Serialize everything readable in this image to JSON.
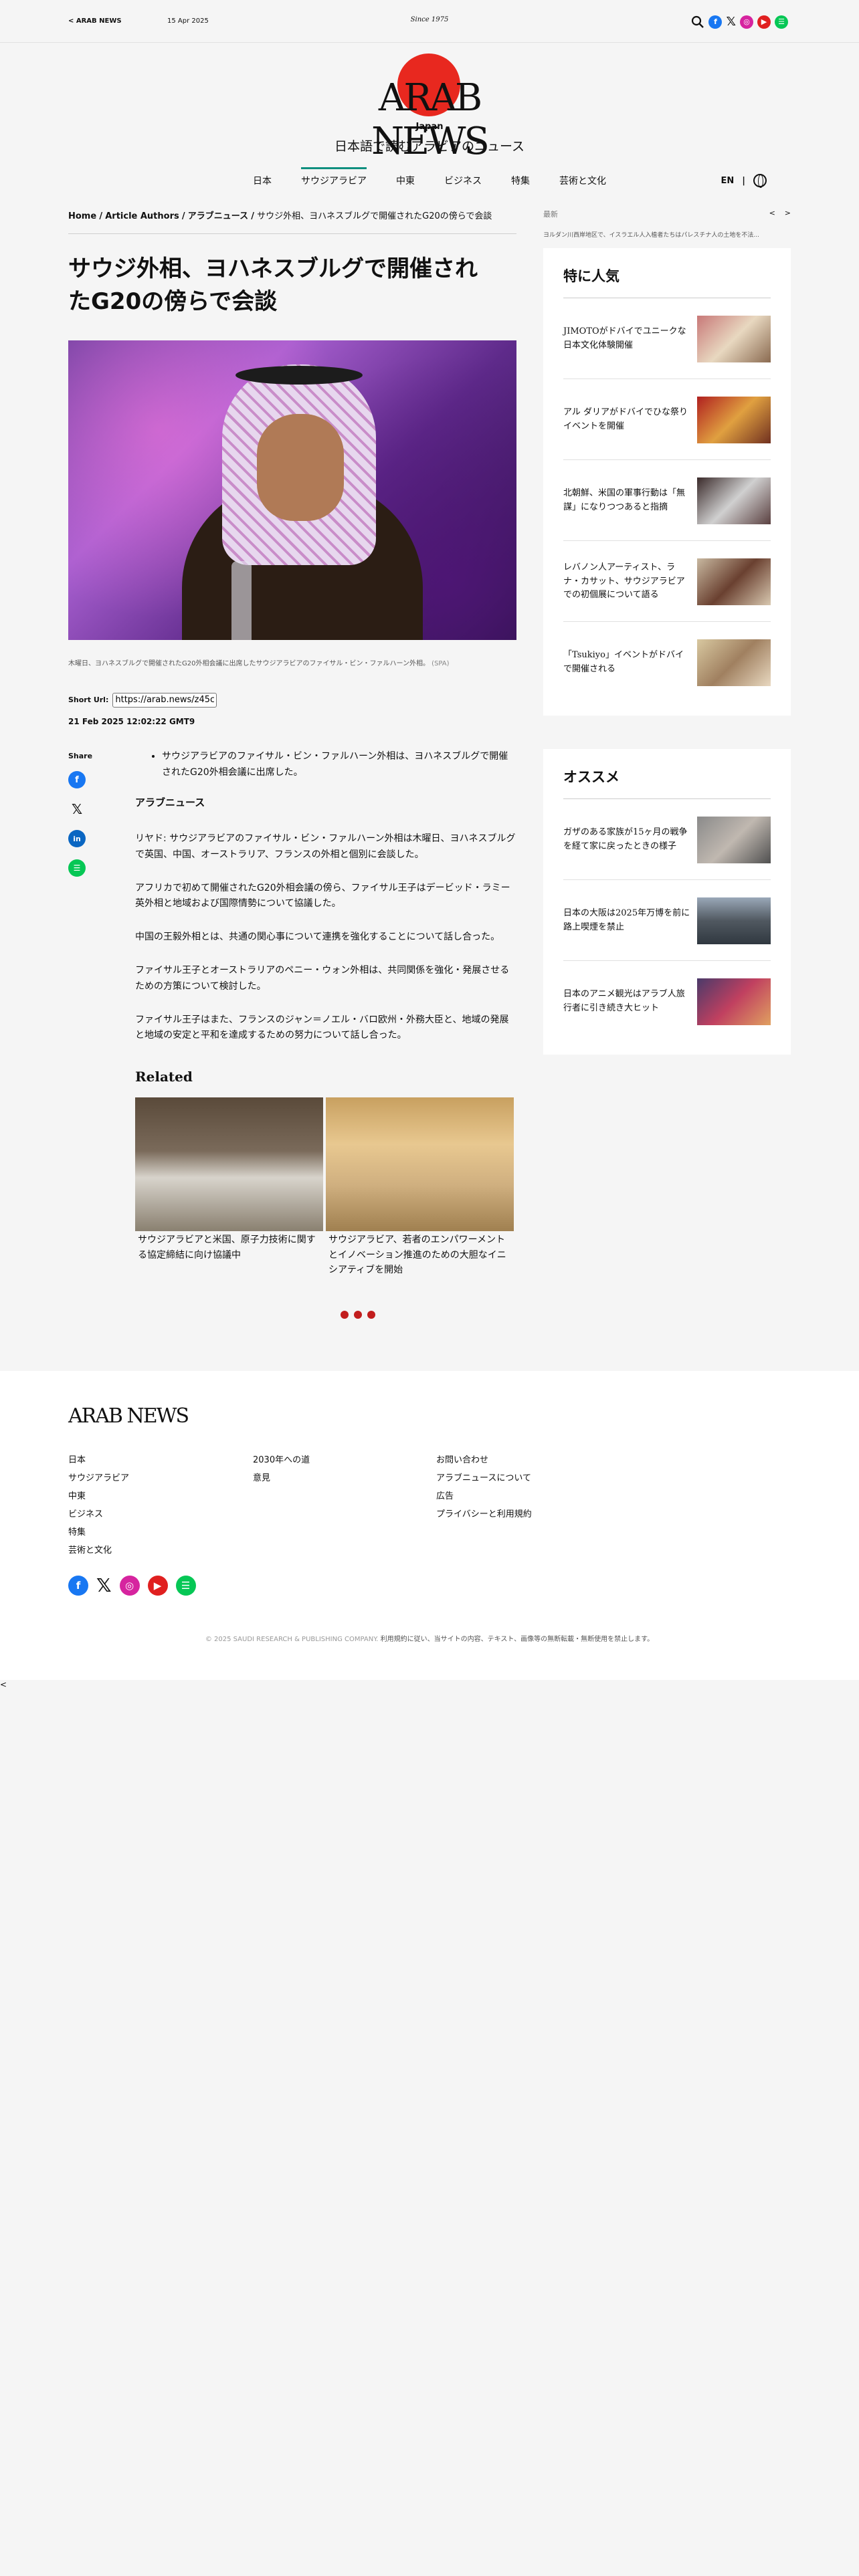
{
  "topbar": {
    "back_label": "< ARAB NEWS",
    "date": "15 Apr 2025",
    "since": "Since 1975"
  },
  "header": {
    "logo_text": "ARAB NEWS",
    "logo_sub": "Japan",
    "tagline": "日本語で読むアラビアのニュース"
  },
  "nav": {
    "items": [
      "日本",
      "サウジアラビア",
      "中東",
      "ビジネス",
      "特集",
      "芸術と文化"
    ],
    "active_index": 1,
    "lang": "EN",
    "divider": "|"
  },
  "breadcrumb": {
    "home": "Home",
    "authors": "Article Authors",
    "section": "アラブニュース",
    "current": "サウジ外相、ヨハネスブルグで開催されたG20の傍らで会談",
    "sep": "/"
  },
  "article": {
    "title": "サウジ外相、ヨハネスブルグで開催されたG20の傍らで会談",
    "caption": "木曜日、ヨハネスブルグで開催されたG20外相会議に出席したサウジアラビアのファイサル・ビン・ファルハーン外相。",
    "caption_source": "(SPA)",
    "short_url_label": "Short Url:",
    "short_url": "https://arab.news/z45c",
    "date": "21 Feb 2025 12:02:22 GMT9",
    "share_label": "Share",
    "bullet": "サウジアラビアのファイサル・ビン・ファルハーン外相は、ヨハネスブルグで開催されたG20外相会議に出席した。",
    "author": "アラブニュース",
    "paragraphs": [
      "リヤド: サウジアラビアのファイサル・ビン・ファルハーン外相は木曜日、ヨハネスブルグで英国、中国、オーストラリア、フランスの外相と個別に会談した。",
      "アフリカで初めて開催されたG20外相会議の傍ら、ファイサル王子はデービッド・ラミー英外相と地域および国際情勢について協議した。",
      "中国の王毅外相とは、共通の関心事について連携を強化することについて話し合った。",
      "ファイサル王子とオーストラリアのペニー・ウォン外相は、共同関係を強化・発展させるための方策について検討した。",
      "ファイサル王子はまた、フランスのジャン＝ノエル・バロ欧州・外務大臣と、地域の発展と地域の安定と平和を達成するための努力について話し合った。"
    ],
    "related_heading": "Related",
    "related": [
      {
        "title": "サウジアラビアと米国、原子力技術に関する協定締結に向け協議中"
      },
      {
        "title": "サウジアラビア、若者のエンパワーメントとイノベーション推進のための大胆なイニシアティブを開始"
      }
    ]
  },
  "sidebar": {
    "ticker_label": "最新",
    "ticker_prev": "<",
    "ticker_next": ">",
    "ticker_text": "ヨルダン川西岸地区で、イスラエル人入植者たちはパレスチナ人の土地を不法...",
    "popular_heading": "特に人気",
    "popular": [
      "JIMOTOがドバイでユニークな日本文化体験開催",
      "アル ダリアがドバイでひな祭りイベントを開催",
      "北朝鮮、米国の軍事行動は「無謀」になりつつあると指摘",
      "レバノン人アーティスト、ラナ・カサット、サウジアラビアでの初個展について語る",
      "「Tsukiyo」イベントがドバイで開催される"
    ],
    "recommend_heading": "オススメ",
    "recommend": [
      "ガザのある家族が15ヶ月の戦争を経て家に戻ったときの様子",
      "日本の大阪は2025年万博を前に路上喫煙を禁止",
      "日本のアニメ観光はアラブ人旅行者に引き続き大ヒット"
    ]
  },
  "footer": {
    "logo_text": "ARAB NEWS",
    "col1": [
      "日本",
      "サウジアラビア",
      "中東",
      "ビジネス",
      "特集",
      "芸術と文化"
    ],
    "col2": [
      "2030年への道",
      "意見"
    ],
    "col3": [
      "お問い合わせ",
      "アラブニュースについて",
      "広告",
      "プライバシーと利用規約"
    ],
    "copyright_muted": "© 2025 SAUDI RESEARCH & PUBLISHING COMPANY.",
    "copyright_rest": "利用規約に従い、当サイトの内容、テキスト、画像等の無断転載・無断使用を禁止します。"
  },
  "stray_char": "<",
  "icons": {
    "facebook": "facebook-icon",
    "x": "x-icon",
    "instagram": "instagram-icon",
    "youtube": "youtube-icon",
    "line": "line-icon",
    "linkedin": "linkedin-icon",
    "search": "search-icon",
    "globe": "globe-icon"
  },
  "colors": {
    "accent_red": "#e8281f",
    "nav_active": "#0f8f7f",
    "facebook": "#1877f2",
    "instagram": "#d6249f",
    "youtube": "#e02020",
    "line": "#06c755",
    "linkedin": "#0a66c2"
  }
}
